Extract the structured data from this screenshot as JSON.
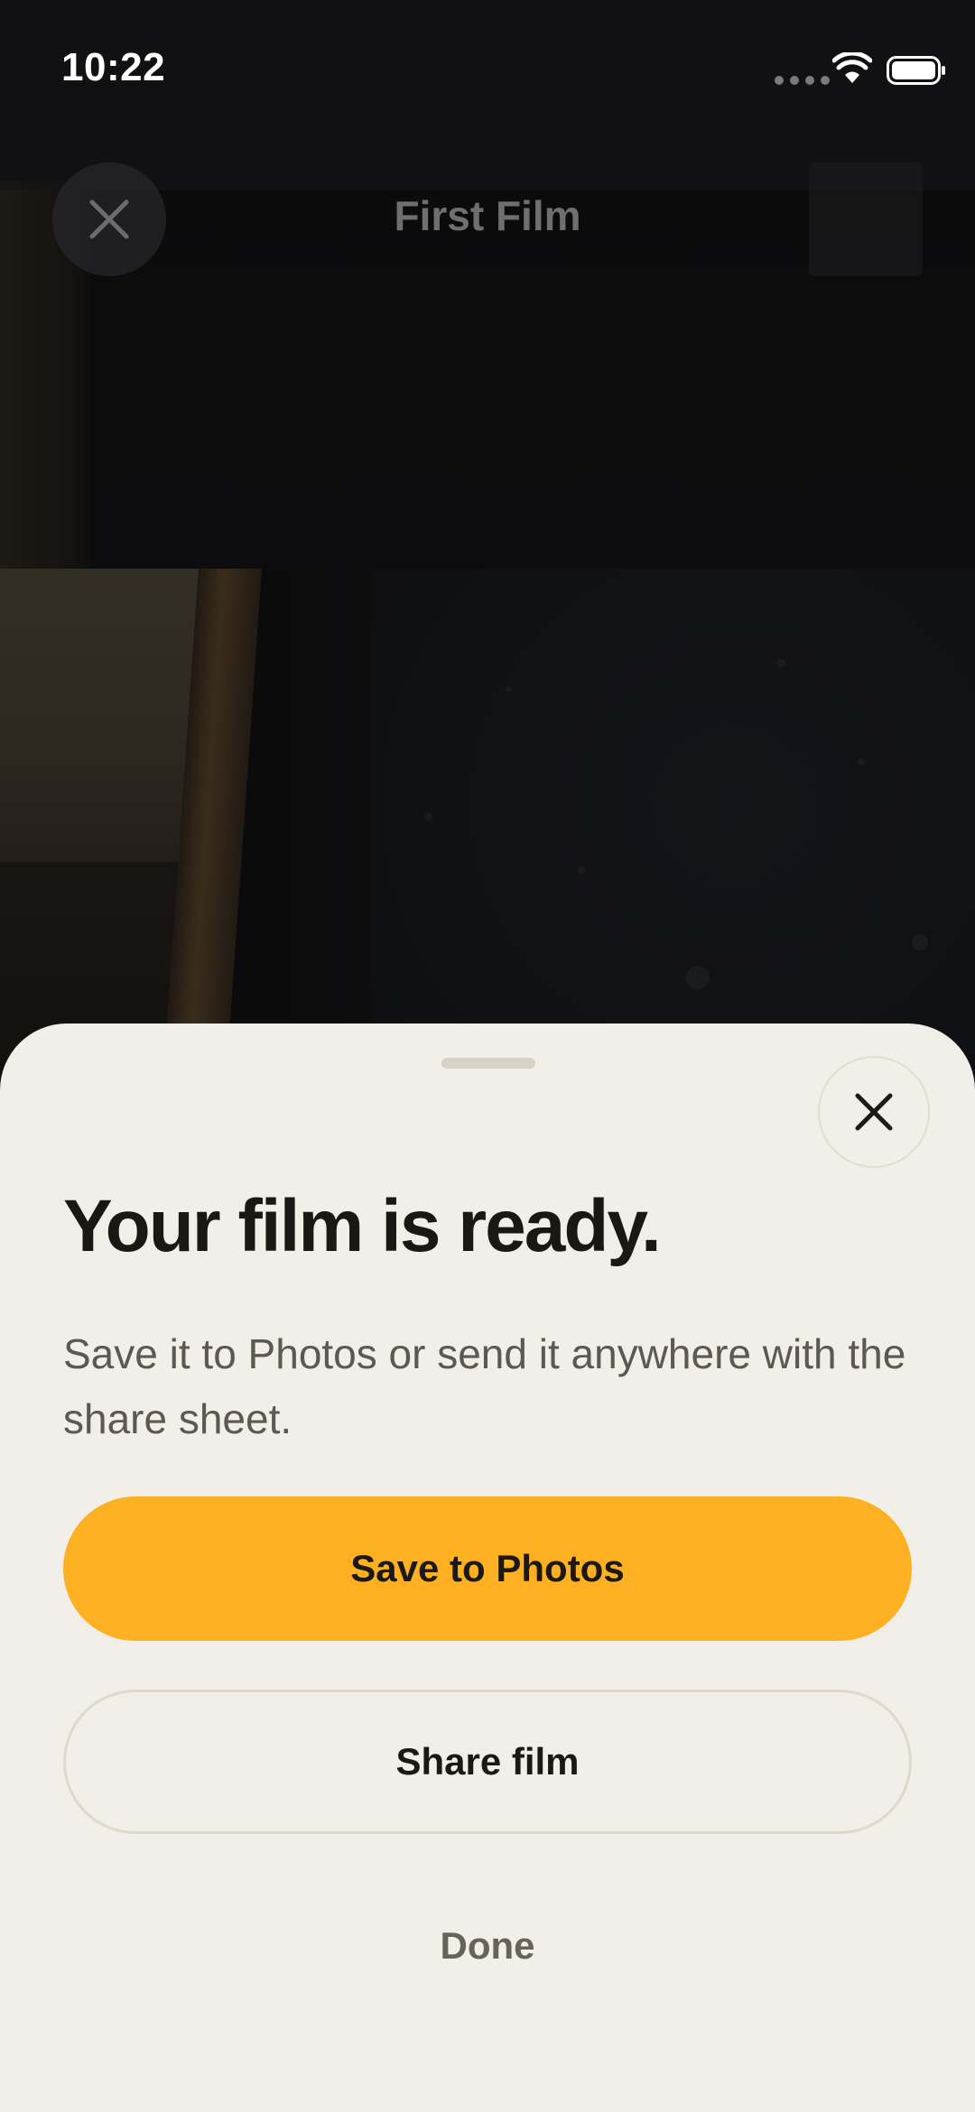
{
  "status_bar": {
    "time": "10:22",
    "icons": [
      "cellular-dots-icon",
      "wifi-icon",
      "battery-icon"
    ]
  },
  "video_header": {
    "title": "First Film",
    "close_icon": "close-icon"
  },
  "sheet": {
    "title": "Your film is ready.",
    "body": "Save it to Photos or send it anywhere with the share sheet.",
    "close_icon": "close-icon",
    "primary_button": "Save to Photos",
    "secondary_button": "Share film",
    "text_button": "Done"
  },
  "colors": {
    "accent": "#fdb022",
    "sheet_background": "#f2efe8",
    "title_text": "#1a1714",
    "body_text": "#5d5851"
  }
}
